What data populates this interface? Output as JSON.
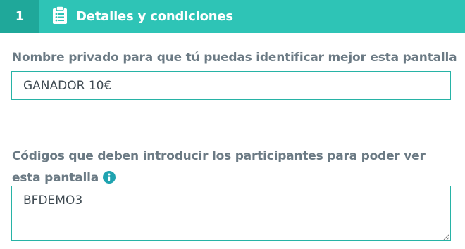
{
  "header": {
    "step_number": "1",
    "title": "Detalles y condiciones",
    "icon": "clipboard-list-icon"
  },
  "fields": {
    "private_name": {
      "label": "Nombre privado para que tú puedas identificar mejor esta pantalla",
      "value": "GANADOR 10€"
    },
    "codes": {
      "label": "Códigos que deben introducir los participantes para poder ver esta pantalla",
      "value": "BFDEMO3",
      "info_icon": "info-icon"
    }
  },
  "colors": {
    "header_bg": "#2ec4b6",
    "step_bg": "#1fa89a",
    "input_border": "#27b3a6",
    "info_icon": "#1fa3b0"
  }
}
